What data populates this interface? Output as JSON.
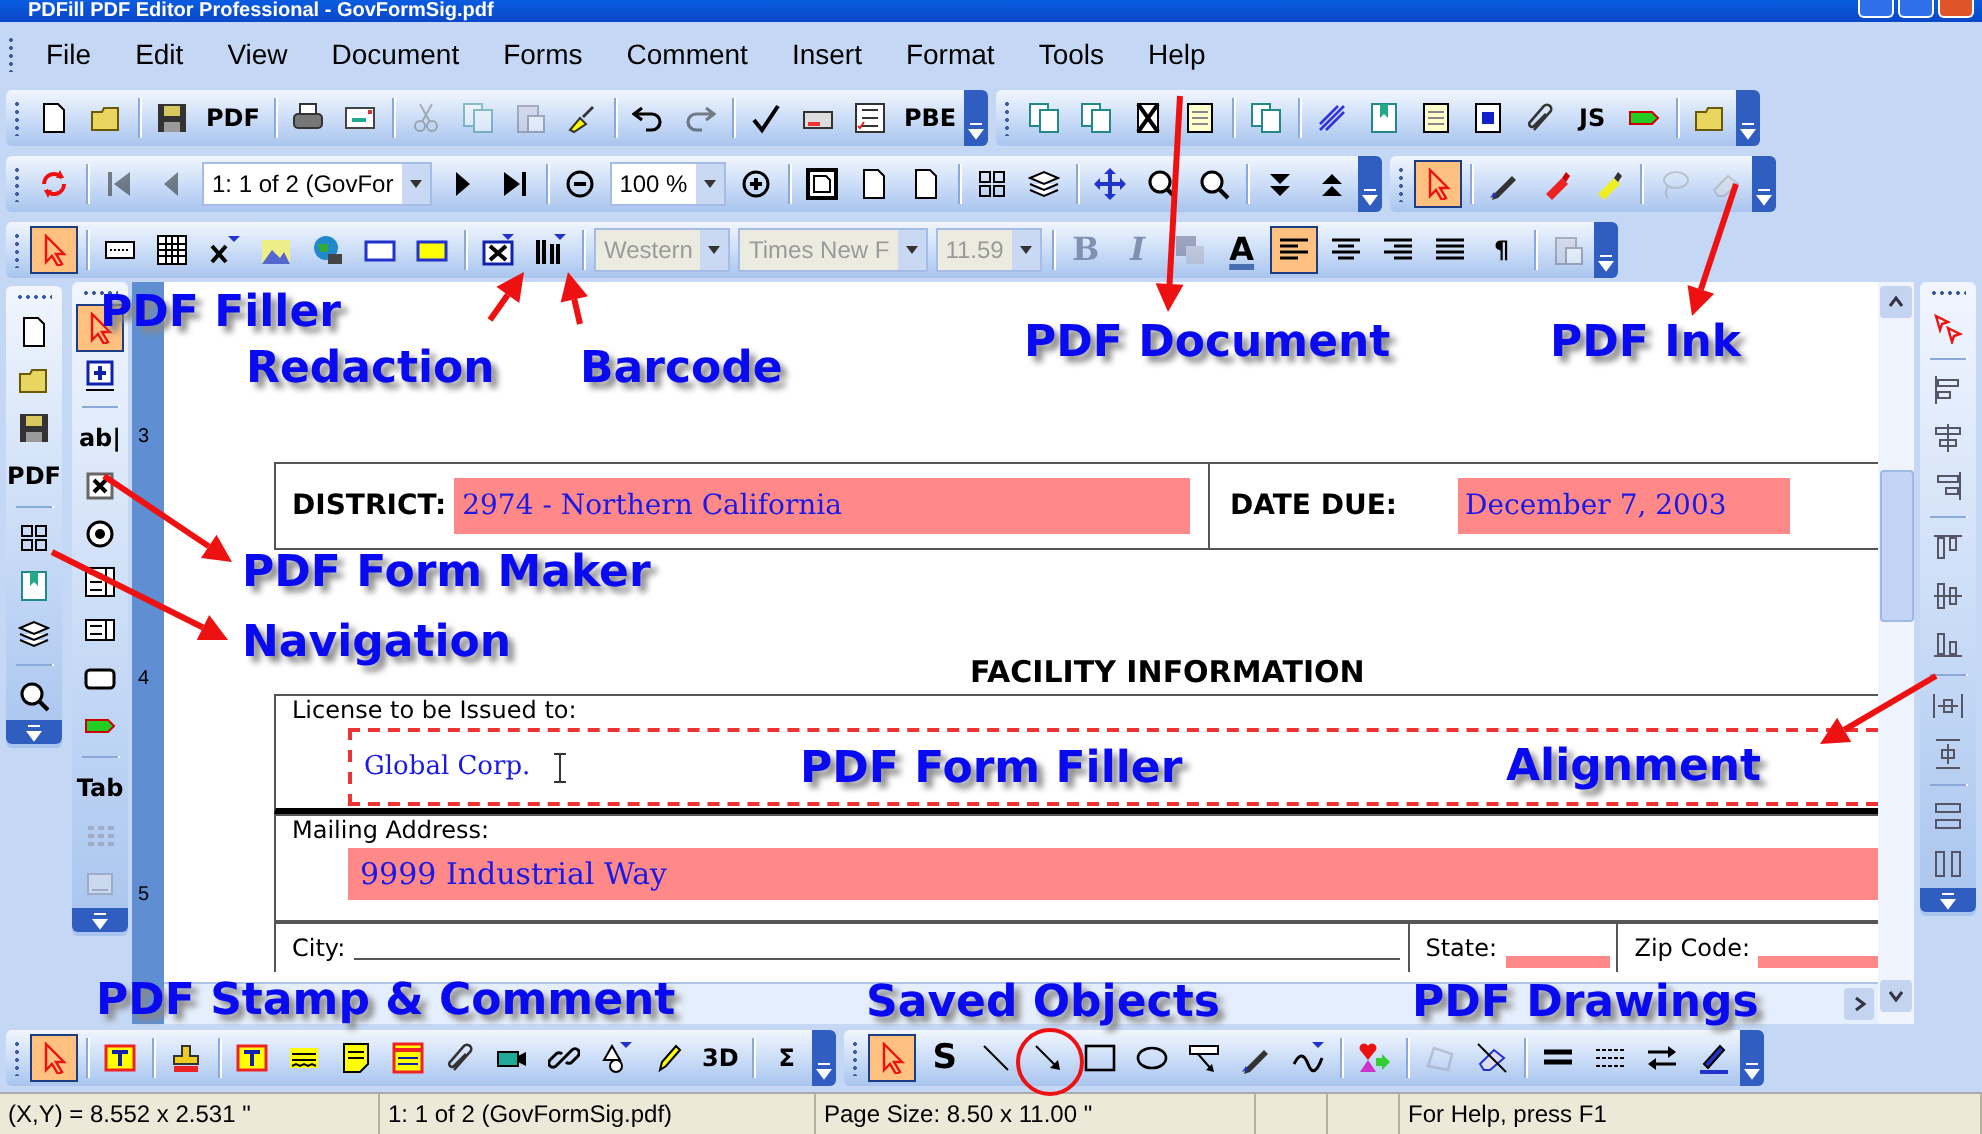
{
  "window": {
    "title": "PDFill PDF Editor Professional - GovFormSig.pdf"
  },
  "menu": [
    {
      "label": "File"
    },
    {
      "label": "Edit"
    },
    {
      "label": "View"
    },
    {
      "label": "Document"
    },
    {
      "label": "Forms"
    },
    {
      "label": "Comment"
    },
    {
      "label": "Insert"
    },
    {
      "label": "Format"
    },
    {
      "label": "Tools"
    },
    {
      "label": "Help"
    }
  ],
  "toolbars": [
    {
      "items": [
        {
          "kind": "icon",
          "selected": false,
          "disabled": false
        },
        {
          "kind": "icon",
          "selected": false,
          "disabled": false
        },
        {
          "kind": "sep"
        },
        {
          "kind": "icon",
          "selected": false,
          "disabled": false
        },
        {
          "kind": "text",
          "label": "PDF",
          "selected": false,
          "disabled": false
        },
        {
          "kind": "sep"
        },
        {
          "kind": "icon",
          "selected": false,
          "disabled": false
        },
        {
          "kind": "icon",
          "selected": false,
          "disabled": false
        },
        {
          "kind": "sep"
        },
        {
          "kind": "icon",
          "selected": false,
          "disabled": true
        },
        {
          "kind": "icon",
          "selected": false,
          "disabled": true
        },
        {
          "kind": "icon",
          "selected": false,
          "disabled": true
        },
        {
          "kind": "icon",
          "selected": false,
          "disabled": false
        },
        {
          "kind": "sep"
        },
        {
          "kind": "icon",
          "selected": false,
          "disabled": false
        },
        {
          "kind": "icon",
          "selected": false,
          "disabled": true
        },
        {
          "kind": "sep"
        },
        {
          "kind": "icon",
          "selected": false,
          "disabled": false
        },
        {
          "kind": "icon",
          "selected": false,
          "disabled": false
        },
        {
          "kind": "icon",
          "selected": false,
          "disabled": false
        },
        {
          "kind": "text",
          "label": "PBE",
          "selected": false,
          "disabled": false
        }
      ]
    },
    {
      "items": [
        {
          "kind": "icon",
          "selected": false,
          "disabled": false
        },
        {
          "kind": "icon",
          "selected": false,
          "disabled": false
        },
        {
          "kind": "icon",
          "selected": false,
          "disabled": false
        },
        {
          "kind": "icon",
          "selected": false,
          "disabled": false
        },
        {
          "kind": "sep"
        },
        {
          "kind": "icon",
          "selected": false,
          "disabled": false
        },
        {
          "kind": "sep"
        },
        {
          "kind": "icon",
          "selected": false,
          "disabled": false
        },
        {
          "kind": "icon",
          "selected": false,
          "disabled": false
        },
        {
          "kind": "icon",
          "selected": false,
          "disabled": false
        },
        {
          "kind": "icon",
          "selected": false,
          "disabled": false
        },
        {
          "kind": "icon",
          "selected": false,
          "disabled": false
        },
        {
          "kind": "text",
          "label": "JS",
          "selected": false,
          "disabled": false
        },
        {
          "kind": "icon",
          "selected": false,
          "disabled": false
        },
        {
          "kind": "sep"
        },
        {
          "kind": "icon",
          "selected": false,
          "disabled": false
        }
      ]
    },
    {
      "items": [
        {
          "kind": "icon",
          "selected": false,
          "disabled": false
        },
        {
          "kind": "sep"
        },
        {
          "kind": "icon",
          "selected": false,
          "disabled": true
        },
        {
          "kind": "icon",
          "selected": false,
          "disabled": true
        },
        {
          "kind": "combo",
          "value": "1: 1 of 2 (GovFor",
          "disabled": false
        },
        {
          "kind": "icon",
          "selected": false,
          "disabled": false
        },
        {
          "kind": "icon",
          "selected": false,
          "disabled": false
        },
        {
          "kind": "sep"
        },
        {
          "kind": "icon",
          "selected": false,
          "disabled": false
        },
        {
          "kind": "combo",
          "value": "100 %",
          "disabled": false
        },
        {
          "kind": "icon",
          "selected": false,
          "disabled": false
        },
        {
          "kind": "sep"
        },
        {
          "kind": "icon",
          "selected": false,
          "disabled": false
        },
        {
          "kind": "icon",
          "selected": false,
          "disabled": false
        },
        {
          "kind": "icon",
          "selected": false,
          "disabled": false
        },
        {
          "kind": "sep"
        },
        {
          "kind": "icon",
          "selected": false,
          "disabled": false
        },
        {
          "kind": "icon",
          "selected": false,
          "disabled": false
        },
        {
          "kind": "sep"
        },
        {
          "kind": "icon",
          "selected": false,
          "disabled": false
        },
        {
          "kind": "icon",
          "selected": false,
          "disabled": false
        },
        {
          "kind": "icon",
          "selected": false,
          "disabled": false
        },
        {
          "kind": "sep"
        },
        {
          "kind": "icon",
          "selected": false,
          "disabled": false
        },
        {
          "kind": "icon",
          "selected": false,
          "disabled": false
        }
      ]
    },
    {
      "items": [
        {
          "kind": "icon",
          "selected": true,
          "disabled": false
        },
        {
          "kind": "sep"
        },
        {
          "kind": "icon",
          "selected": false,
          "disabled": false
        },
        {
          "kind": "icon",
          "selected": false,
          "disabled": false
        },
        {
          "kind": "icon",
          "selected": false,
          "disabled": false
        },
        {
          "kind": "sep"
        },
        {
          "kind": "icon",
          "selected": false,
          "disabled": true
        },
        {
          "kind": "icon",
          "selected": false,
          "disabled": true
        }
      ]
    },
    {
      "items": [
        {
          "kind": "icon",
          "selected": true,
          "disabled": false
        },
        {
          "kind": "sep"
        },
        {
          "kind": "icon",
          "selected": false,
          "disabled": false
        },
        {
          "kind": "icon",
          "selected": false,
          "disabled": false
        },
        {
          "kind": "icon",
          "selected": false,
          "disabled": false
        },
        {
          "kind": "icon",
          "selected": false,
          "disabled": false
        },
        {
          "kind": "icon",
          "selected": false,
          "disabled": false
        },
        {
          "kind": "icon",
          "selected": false,
          "disabled": false
        },
        {
          "kind": "icon",
          "selected": false,
          "disabled": false
        },
        {
          "kind": "sep"
        },
        {
          "kind": "icon",
          "selected": false,
          "disabled": false
        },
        {
          "kind": "icon",
          "selected": false,
          "disabled": false
        },
        {
          "kind": "sep"
        },
        {
          "kind": "combo",
          "value": "Western",
          "disabled": true
        },
        {
          "kind": "combo",
          "value": "Times New F",
          "disabled": true
        },
        {
          "kind": "combo",
          "value": "11.59",
          "disabled": true
        },
        {
          "kind": "sep"
        },
        {
          "kind": "text",
          "label": "B",
          "selected": false,
          "disabled": true
        },
        {
          "kind": "text",
          "label": "I",
          "selected": false,
          "disabled": true
        },
        {
          "kind": "icon",
          "selected": false,
          "disabled": true
        },
        {
          "kind": "text",
          "label": "A",
          "selected": false,
          "disabled": false
        },
        {
          "kind": "icon",
          "selected": true,
          "disabled": false
        },
        {
          "kind": "icon",
          "selected": false,
          "disabled": false
        },
        {
          "kind": "icon",
          "selected": false,
          "disabled": false
        },
        {
          "kind": "icon",
          "selected": false,
          "disabled": false
        },
        {
          "kind": "text",
          "label": "¶",
          "selected": false,
          "disabled": false
        },
        {
          "kind": "sep"
        },
        {
          "kind": "icon",
          "selected": false,
          "disabled": true
        }
      ]
    },
    {
      "items": [
        {
          "kind": "icon",
          "selected": false,
          "disabled": false
        },
        {
          "kind": "icon",
          "selected": false,
          "disabled": false
        },
        {
          "kind": "icon",
          "selected": false,
          "disabled": false
        },
        {
          "kind": "text",
          "label": "PDF",
          "selected": false,
          "disabled": false
        },
        {
          "kind": "sep"
        },
        {
          "kind": "icon",
          "selected": false,
          "disabled": false
        },
        {
          "kind": "icon",
          "selected": false,
          "disabled": false
        },
        {
          "kind": "icon",
          "selected": false,
          "disabled": false
        },
        {
          "kind": "sep"
        },
        {
          "kind": "icon",
          "selected": false,
          "disabled": false
        }
      ]
    },
    {
      "items": [
        {
          "kind": "icon",
          "selected": true,
          "disabled": false
        },
        {
          "kind": "icon",
          "selected": false,
          "disabled": false
        },
        {
          "kind": "sep"
        },
        {
          "kind": "text",
          "label": "ab|",
          "selected": false,
          "disabled": false
        },
        {
          "kind": "icon",
          "selected": false,
          "disabled": false
        },
        {
          "kind": "icon",
          "selected": false,
          "disabled": false
        },
        {
          "kind": "icon",
          "selected": false,
          "disabled": false
        },
        {
          "kind": "icon",
          "selected": false,
          "disabled": false
        },
        {
          "kind": "icon",
          "selected": false,
          "disabled": false
        },
        {
          "kind": "icon",
          "selected": false,
          "disabled": false
        },
        {
          "kind": "sep"
        },
        {
          "kind": "text",
          "label": "Tab",
          "selected": false,
          "disabled": false
        },
        {
          "kind": "icon",
          "selected": false,
          "disabled": true
        },
        {
          "kind": "icon",
          "selected": false,
          "disabled": true
        }
      ]
    },
    {
      "items": [
        {
          "kind": "icon",
          "selected": false,
          "disabled": false
        },
        {
          "kind": "sep"
        },
        {
          "kind": "icon",
          "selected": false,
          "disabled": false
        },
        {
          "kind": "icon",
          "selected": false,
          "disabled": false
        },
        {
          "kind": "icon",
          "selected": false,
          "disabled": false
        },
        {
          "kind": "sep"
        },
        {
          "kind": "icon",
          "selected": false,
          "disabled": false
        },
        {
          "kind": "icon",
          "selected": false,
          "disabled": false
        },
        {
          "kind": "icon",
          "selected": false,
          "disabled": false
        },
        {
          "kind": "sep"
        },
        {
          "kind": "icon",
          "selected": false,
          "disabled": false
        },
        {
          "kind": "icon",
          "selected": false,
          "disabled": false
        },
        {
          "kind": "sep"
        },
        {
          "kind": "icon",
          "selected": false,
          "disabled": false
        },
        {
          "kind": "icon",
          "selected": false,
          "disabled": false
        }
      ]
    },
    {
      "items": [
        {
          "kind": "icon",
          "selected": true,
          "disabled": false
        },
        {
          "kind": "sep"
        },
        {
          "kind": "icon",
          "selected": false,
          "disabled": false
        },
        {
          "kind": "sep"
        },
        {
          "kind": "icon",
          "selected": false,
          "disabled": false
        },
        {
          "kind": "sep"
        },
        {
          "kind": "icon",
          "selected": false,
          "disabled": false
        },
        {
          "kind": "icon",
          "selected": false,
          "disabled": false
        },
        {
          "kind": "icon",
          "selected": false,
          "disabled": false
        },
        {
          "kind": "icon",
          "selected": false,
          "disabled": false
        },
        {
          "kind": "icon",
          "selected": false,
          "disabled": false
        },
        {
          "kind": "icon",
          "selected": false,
          "disabled": false
        },
        {
          "kind": "icon",
          "selected": false,
          "disabled": false
        },
        {
          "kind": "icon",
          "selected": false,
          "disabled": false
        },
        {
          "kind": "icon",
          "selected": false,
          "disabled": false
        },
        {
          "kind": "text",
          "label": "3D",
          "selected": false,
          "disabled": false
        },
        {
          "kind": "sep"
        },
        {
          "kind": "text",
          "label": "Σ",
          "selected": false,
          "disabled": false
        }
      ]
    },
    {
      "items": [
        {
          "kind": "icon",
          "selected": true,
          "disabled": false
        },
        {
          "kind": "text",
          "label": "S",
          "selected": false,
          "disabled": false
        },
        {
          "kind": "icon",
          "selected": false,
          "disabled": false
        },
        {
          "kind": "icon",
          "selected": false,
          "disabled": false
        },
        {
          "kind": "icon",
          "selected": false,
          "disabled": false
        },
        {
          "kind": "icon",
          "selected": false,
          "disabled": false
        },
        {
          "kind": "icon",
          "selected": false,
          "disabled": false
        },
        {
          "kind": "icon",
          "selected": false,
          "disabled": false
        },
        {
          "kind": "icon",
          "selected": false,
          "disabled": false
        },
        {
          "kind": "sep"
        },
        {
          "kind": "icon",
          "selected": false,
          "disabled": false
        },
        {
          "kind": "sep"
        },
        {
          "kind": "icon",
          "selected": false,
          "disabled": true
        },
        {
          "kind": "icon",
          "selected": false,
          "disabled": false
        },
        {
          "kind": "sep"
        },
        {
          "kind": "icon",
          "selected": false,
          "disabled": false
        },
        {
          "kind": "icon",
          "selected": false,
          "disabled": false
        },
        {
          "kind": "icon",
          "selected": false,
          "disabled": false
        },
        {
          "kind": "icon",
          "selected": false,
          "disabled": false
        }
      ]
    }
  ],
  "ruler": [
    "3",
    "4",
    "5"
  ],
  "document": {
    "district_label": "DISTRICT:",
    "district": "2974 - Northern California",
    "date_label": "DATE DUE:",
    "date": "December 7, 2003",
    "section_title": "FACILITY INFORMATION",
    "license_label": "License to be Issued to:",
    "license": "Global Corp.",
    "mailing_label": "Mailing Address:",
    "mailing": "9999 Industrial Way",
    "city_label": "City:",
    "state_label": "State:",
    "zip_label": "Zip Code:"
  },
  "callouts": [
    {
      "text": "PDF Filler"
    },
    {
      "text": "Redaction"
    },
    {
      "text": "Barcode"
    },
    {
      "text": "PDF Document"
    },
    {
      "text": "PDF Ink"
    },
    {
      "text": "PDF Form Maker"
    },
    {
      "text": "Navigation"
    },
    {
      "text": "PDF Form Filler"
    },
    {
      "text": "Alignment"
    },
    {
      "text": "PDF Stamp & Comment"
    },
    {
      "text": "Saved Objects"
    },
    {
      "text": "PDF Drawings"
    }
  ],
  "status_bar": [
    {
      "text": "(X,Y) = 8.552 x 2.531 \""
    },
    {
      "text": "1: 1 of 2 (GovFormSig.pdf)"
    },
    {
      "text": "Page Size: 8.50 x 11.00 \""
    },
    {
      "text": "For Help, press F1"
    }
  ]
}
